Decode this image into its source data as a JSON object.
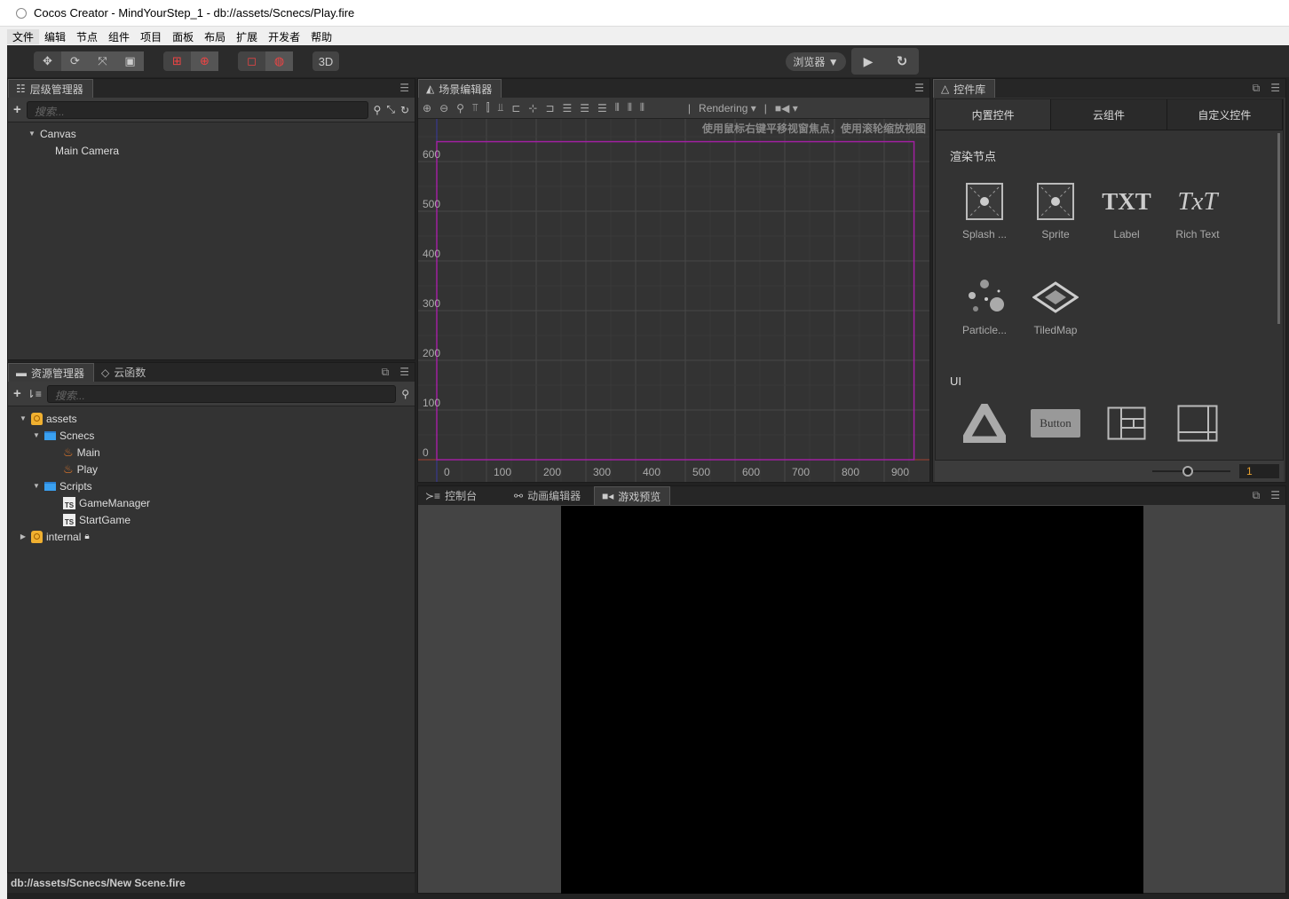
{
  "window": {
    "title": "Cocos Creator - MindYourStep_1 - db://assets/Scnecs/Play.fire"
  },
  "menu": [
    "文件",
    "编辑",
    "节点",
    "组件",
    "项目",
    "面板",
    "布局",
    "扩展",
    "开发者",
    "帮助"
  ],
  "toolbar": {
    "mode_3d": "3D",
    "platform": "浏览器 ▼",
    "icons": [
      "move-icon",
      "rotate-icon",
      "scale-icon",
      "rect-icon",
      "anchor-pivot-icon",
      "anchor-center-icon",
      "local-icon",
      "global-icon",
      "play-icon",
      "refresh-icon"
    ]
  },
  "hierarchy": {
    "title": "层级管理器",
    "search_placeholder": "搜索...",
    "nodes": [
      {
        "label": "Canvas",
        "depth": 0,
        "expanded": true
      },
      {
        "label": "Main Camera",
        "depth": 1
      }
    ]
  },
  "assets": {
    "title": "资源管理器",
    "tab2": "云函数",
    "search_placeholder": "搜索...",
    "items": [
      {
        "label": "assets",
        "depth": 0,
        "type": "db",
        "caret": "down"
      },
      {
        "label": "Scnecs",
        "depth": 1,
        "type": "folder",
        "caret": "down"
      },
      {
        "label": "Main",
        "depth": 2,
        "type": "scene"
      },
      {
        "label": "Play",
        "depth": 2,
        "type": "scene"
      },
      {
        "label": "Scripts",
        "depth": 1,
        "type": "folder",
        "caret": "down"
      },
      {
        "label": "GameManager",
        "depth": 2,
        "type": "ts"
      },
      {
        "label": "StartGame",
        "depth": 2,
        "type": "ts"
      },
      {
        "label": "internal",
        "depth": 0,
        "type": "db",
        "caret": "right",
        "locked": true
      }
    ]
  },
  "status": {
    "path": "db://assets/Scnecs/New Scene.fire"
  },
  "scene": {
    "title": "场景编辑器",
    "rendering": "Rendering",
    "hint": "使用鼠标右键平移视窗焦点，使用滚轮缩放视图",
    "x_ticks": [
      "0",
      "100",
      "200",
      "300",
      "400",
      "500",
      "600",
      "700",
      "800",
      "900"
    ],
    "y_ticks": [
      "0",
      "100",
      "200",
      "300",
      "400",
      "500",
      "600"
    ],
    "design_size": [
      960,
      640
    ],
    "colors": {
      "design_rect": "#a020a0"
    }
  },
  "library": {
    "title": "控件库",
    "tabs": [
      "内置控件",
      "云组件",
      "自定义控件"
    ],
    "section1": "渲染节点",
    "section2": "UI",
    "render_items": [
      "Splash ...",
      "Sprite",
      "Label",
      "Rich Text",
      "Particle...",
      "TiledMap"
    ],
    "label_glyph": "TXT",
    "richtext_glyph": "TxT",
    "button_glyph": "Button",
    "zoom_value": "1",
    "zoom_slider": 0.45
  },
  "bottom": {
    "tabs": [
      "控制台",
      "动画编辑器",
      "游戏预览"
    ],
    "active_tab": 2
  }
}
